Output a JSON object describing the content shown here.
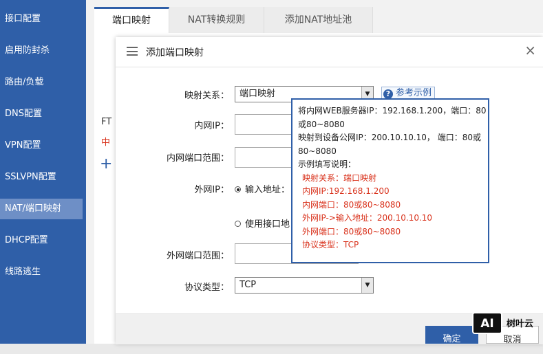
{
  "sidebar": {
    "items": [
      {
        "label": "接口配置"
      },
      {
        "label": "启用防封杀"
      },
      {
        "label": "路由/负载"
      },
      {
        "label": "DNS配置"
      },
      {
        "label": "VPN配置"
      },
      {
        "label": "SSLVPN配置"
      },
      {
        "label": "NAT/端口映射",
        "active": true
      },
      {
        "label": "DHCP配置"
      },
      {
        "label": "线路逃生"
      }
    ]
  },
  "tabs": [
    {
      "label": "端口映射",
      "active": true
    },
    {
      "label": "NAT转换规则"
    },
    {
      "label": "添加NAT地址池"
    }
  ],
  "background": {
    "ft_text": "FT",
    "zh_text": "中",
    "plus": "+"
  },
  "dialog": {
    "title": "添加端口映射",
    "close": "×",
    "mapping_label": "映射关系：",
    "mapping_value": "端口映射",
    "help_label": "参考示例",
    "internal_ip_label": "内网IP：",
    "internal_port_label": "内网端口范围：",
    "external_ip_label": "外网IP：",
    "radio_input_address": "输入地址：",
    "radio_use_interface": "使用接口地",
    "external_port_label": "外网端口范围：",
    "protocol_label": "协议类型：",
    "protocol_value": "TCP",
    "ok_label": "确定",
    "cancel_label": "取消"
  },
  "example_popup": {
    "lines": [
      "将内网WEB服务器IP：192.168.1.200，端口：80",
      "或80~8080",
      "映射到设备公网IP：200.10.10.10， 端口：80或",
      "80~8080",
      "示例填写说明："
    ],
    "red_lines": [
      "映射关系：端口映射",
      "内网IP:192.168.1.200",
      "内网端口：80或80~8080",
      "外网IP->输入地址：200.10.10.10",
      "外网端口：80或80~8080",
      "协议类型：TCP"
    ]
  },
  "watermark": {
    "logo": "AI",
    "text": "树叶云"
  },
  "colors": {
    "sidebar": "#2f5fa8",
    "accent": "#2f5fa8",
    "red": "#d9321c"
  }
}
